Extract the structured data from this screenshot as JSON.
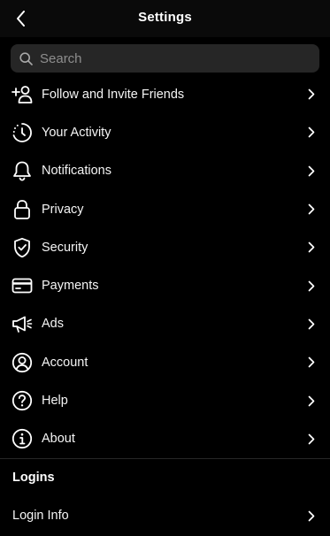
{
  "header": {
    "title": "Settings",
    "back_icon": "chevron-left-icon"
  },
  "search": {
    "placeholder": "Search",
    "value": "",
    "icon": "search-icon"
  },
  "menu": {
    "items": [
      {
        "label": "Follow and Invite Friends",
        "icon": "add-person-icon"
      },
      {
        "label": "Your Activity",
        "icon": "activity-clock-icon"
      },
      {
        "label": "Notifications",
        "icon": "bell-icon"
      },
      {
        "label": "Privacy",
        "icon": "lock-icon"
      },
      {
        "label": "Security",
        "icon": "shield-check-icon"
      },
      {
        "label": "Payments",
        "icon": "credit-card-icon"
      },
      {
        "label": "Ads",
        "icon": "megaphone-icon"
      },
      {
        "label": "Account",
        "icon": "user-circle-icon"
      },
      {
        "label": "Help",
        "icon": "help-circle-icon"
      },
      {
        "label": "About",
        "icon": "info-circle-icon"
      }
    ]
  },
  "logins": {
    "section_title": "Logins",
    "items": [
      {
        "label": "Login Info"
      }
    ]
  },
  "colors": {
    "background": "#000000",
    "header_background": "#0a0a0a",
    "search_background": "#262626",
    "text": "#ffffff",
    "placeholder": "#8e8e8e",
    "divider": "#262626"
  }
}
